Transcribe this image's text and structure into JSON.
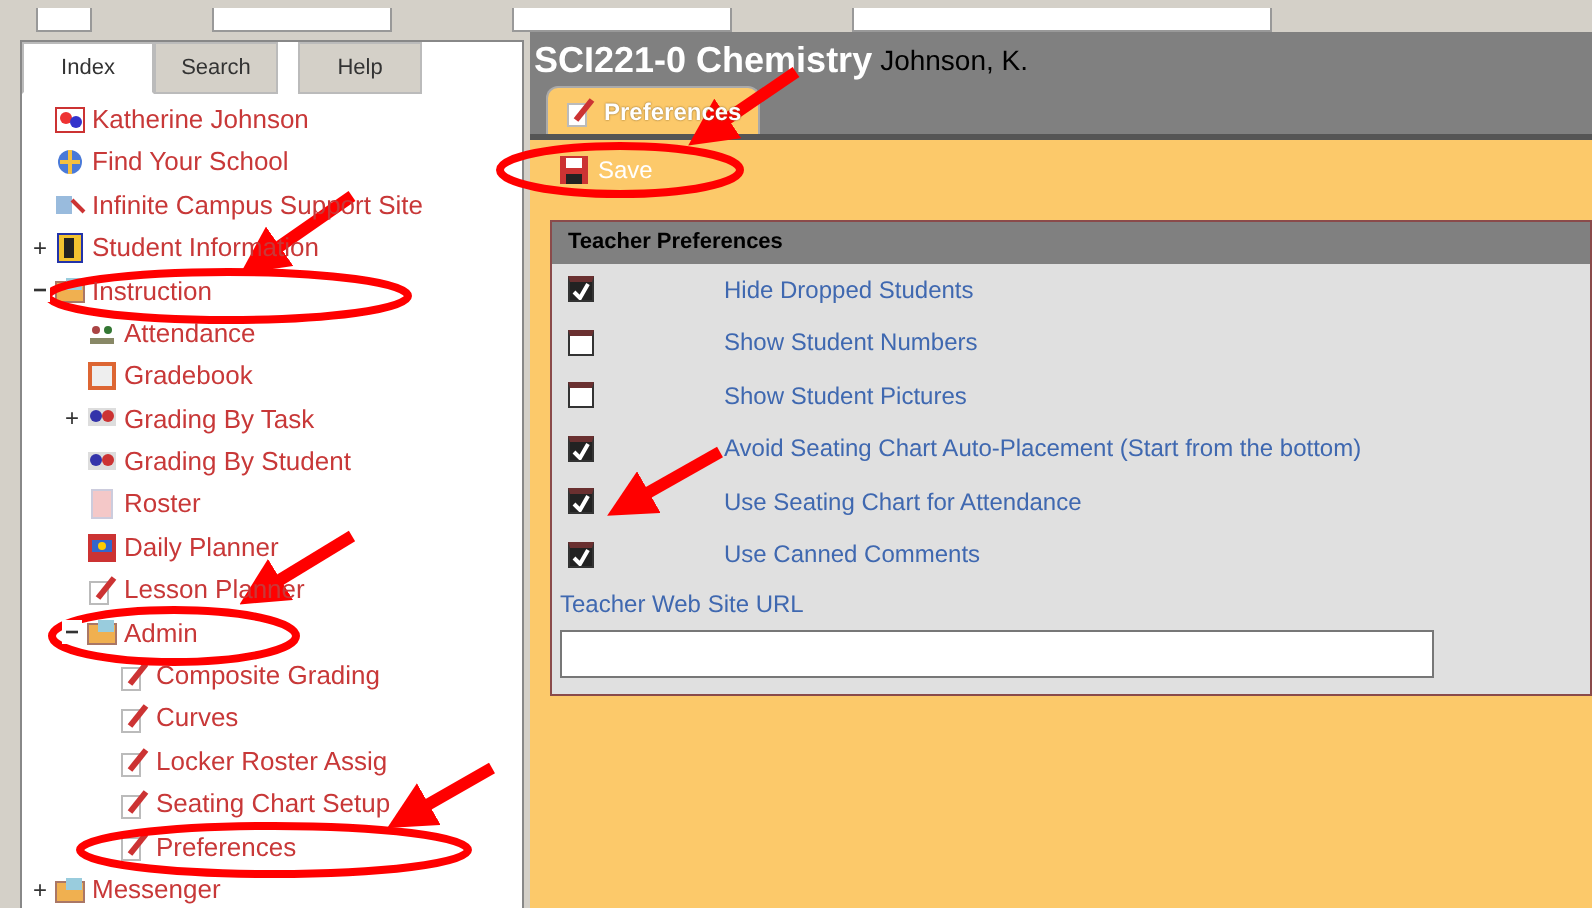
{
  "sidebar": {
    "tabs": [
      {
        "label": "Index",
        "selected": true
      },
      {
        "label": "Search",
        "selected": false
      },
      {
        "label": "Help",
        "selected": false
      }
    ],
    "tree": [
      {
        "label": "Katherine Johnson",
        "kind": "person"
      },
      {
        "label": "Find Your School",
        "kind": "globe"
      },
      {
        "label": "Infinite Campus Support Site",
        "kind": "support"
      },
      {
        "label": "Student Information",
        "kind": "student",
        "expanded": false,
        "toggle": "+"
      },
      {
        "label": "Instruction",
        "kind": "folder",
        "expanded": true,
        "toggle": "−",
        "children": [
          {
            "label": "Attendance",
            "kind": "attendance"
          },
          {
            "label": "Gradebook",
            "kind": "gradebook"
          },
          {
            "label": "Grading By Task",
            "kind": "grading",
            "expanded": false,
            "toggle": "+"
          },
          {
            "label": "Grading By Student",
            "kind": "grading"
          },
          {
            "label": "Roster",
            "kind": "roster"
          },
          {
            "label": "Daily Planner",
            "kind": "planner"
          },
          {
            "label": "Lesson Planner",
            "kind": "tool"
          },
          {
            "label": "Admin",
            "kind": "folder",
            "expanded": true,
            "toggle": "−",
            "children": [
              {
                "label": "Composite Grading",
                "kind": "tool"
              },
              {
                "label": "Curves",
                "kind": "tool"
              },
              {
                "label": "Locker Roster Assig",
                "kind": "tool"
              },
              {
                "label": "Seating Chart Setup",
                "kind": "tool"
              },
              {
                "label": "Preferences",
                "kind": "tool"
              }
            ]
          }
        ]
      },
      {
        "label": "Messenger",
        "kind": "folder",
        "expanded": false,
        "toggle": "+"
      }
    ]
  },
  "header": {
    "section": "SCI221-0 Chemistry",
    "teacher": "Johnson, K."
  },
  "tabs": [
    {
      "label": "Preferences",
      "selected": true
    }
  ],
  "toolbar": {
    "save": "Save"
  },
  "panel": {
    "title": "Teacher Preferences",
    "options": [
      {
        "label": "Hide Dropped Students",
        "checked": true
      },
      {
        "label": "Show Student Numbers",
        "checked": false
      },
      {
        "label": "Show Student Pictures",
        "checked": false
      },
      {
        "label": "Avoid Seating Chart Auto-Placement (Start from the bottom)",
        "checked": true
      },
      {
        "label": "Use Seating Chart for Attendance",
        "checked": true
      },
      {
        "label": "Use Canned Comments",
        "checked": true
      }
    ],
    "url_label": "Teacher Web Site URL"
  }
}
